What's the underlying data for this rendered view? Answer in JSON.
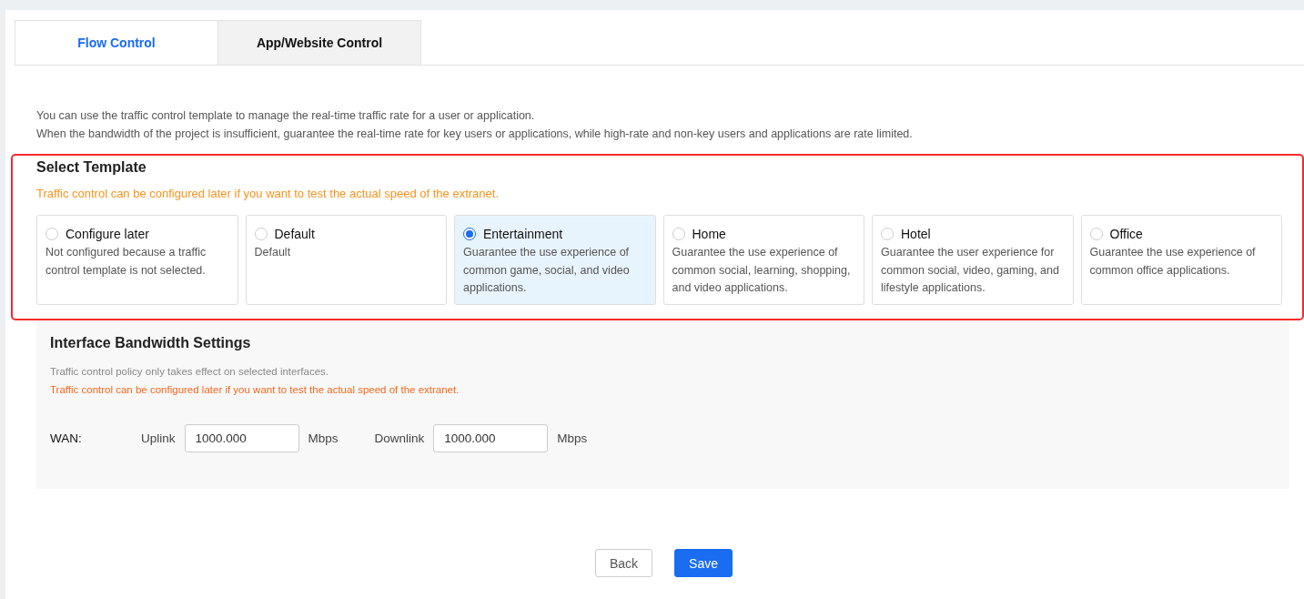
{
  "tabs": [
    {
      "label": "Flow Control",
      "selected": true
    },
    {
      "label": "App/Website Control",
      "selected": false
    }
  ],
  "intro": [
    "You can use the traffic control template to manage the real-time traffic rate for a user or application.",
    "When the bandwidth of the project is insufficient, guarantee the real-time rate for key users or applications, while high-rate and non-key users and applications are rate limited."
  ],
  "select_template": {
    "title": "Select Template",
    "note": "Traffic control can be configured later if you want to test the actual speed of the extranet.",
    "options": [
      {
        "label": "Configure later",
        "description": "Not configured because a traffic control template is not selected.",
        "selected": false
      },
      {
        "label": "Default",
        "description": "Default",
        "selected": false
      },
      {
        "label": "Entertainment",
        "description": "Guarantee the use experience of common game, social, and video applications.",
        "selected": true
      },
      {
        "label": "Home",
        "description": "Guarantee the use experience of common social, learning, shopping, and video applications.",
        "selected": false
      },
      {
        "label": "Hotel",
        "description": "Guarantee the user experience for common social, video, gaming, and lifestyle applications.",
        "selected": false
      },
      {
        "label": "Office",
        "description": "Guarantee the use experience of common office applications.",
        "selected": false
      }
    ]
  },
  "bandwidth": {
    "title": "Interface Bandwidth Settings",
    "hint": "Traffic control policy only takes effect on selected interfaces.",
    "note": "Traffic control can be configured later if you want to test the actual speed of the extranet.",
    "interface": "WAN:",
    "uplink_label": "Uplink",
    "uplink_value": "1000.000",
    "uplink_unit": "Mbps",
    "downlink_label": "Downlink",
    "downlink_value": "1000.000",
    "downlink_unit": "Mbps"
  },
  "buttons": {
    "back": "Back",
    "save": "Save"
  }
}
